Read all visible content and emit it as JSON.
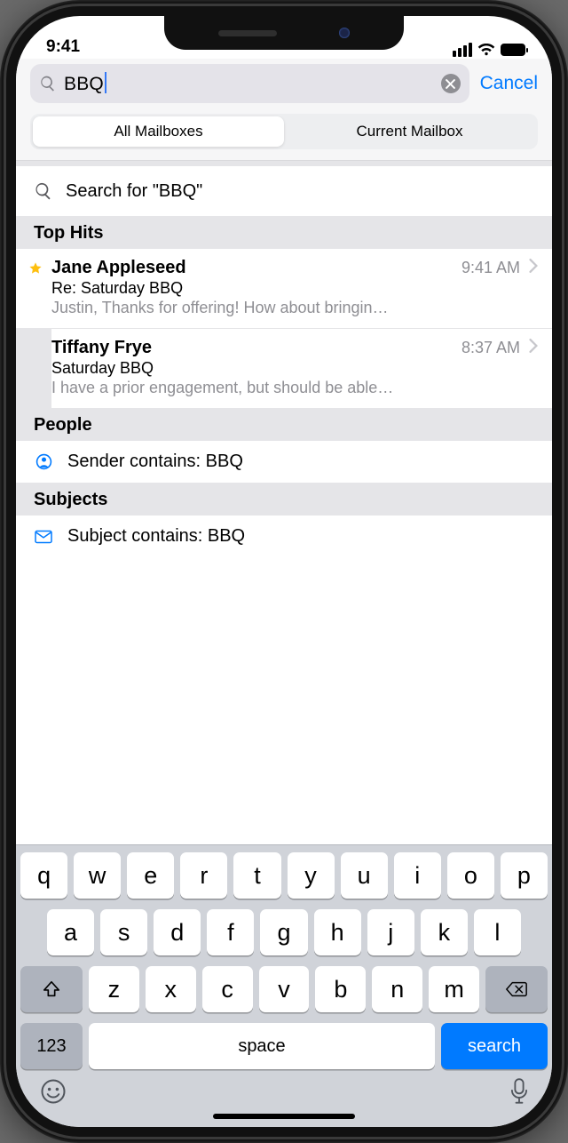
{
  "statusbar": {
    "time": "9:41"
  },
  "search": {
    "value": "BBQ",
    "cancel": "Cancel",
    "segments": [
      "All Mailboxes",
      "Current Mailbox"
    ],
    "active_segment": 0,
    "search_for_label": "Search for \"BBQ\""
  },
  "sections": {
    "top_hits": "Top Hits",
    "people": "People",
    "subjects": "Subjects"
  },
  "top_hits": [
    {
      "starred": true,
      "from": "Jane Appleseed",
      "time": "9:41 AM",
      "subject": "Re:  Saturday BBQ",
      "preview": "Justin, Thanks for offering! How about bringin…"
    },
    {
      "starred": false,
      "from": "Tiffany Frye",
      "time": "8:37 AM",
      "subject": "Saturday BBQ",
      "preview": "I have a prior engagement, but should be able…"
    }
  ],
  "people_suggestion": "Sender contains: BBQ",
  "subject_suggestion": "Subject contains: BBQ",
  "keyboard": {
    "row1": [
      "q",
      "w",
      "e",
      "r",
      "t",
      "y",
      "u",
      "i",
      "o",
      "p"
    ],
    "row2": [
      "a",
      "s",
      "d",
      "f",
      "g",
      "h",
      "j",
      "k",
      "l"
    ],
    "row3": [
      "z",
      "x",
      "c",
      "v",
      "b",
      "n",
      "m"
    ],
    "numkey": "123",
    "space": "space",
    "action": "search"
  }
}
